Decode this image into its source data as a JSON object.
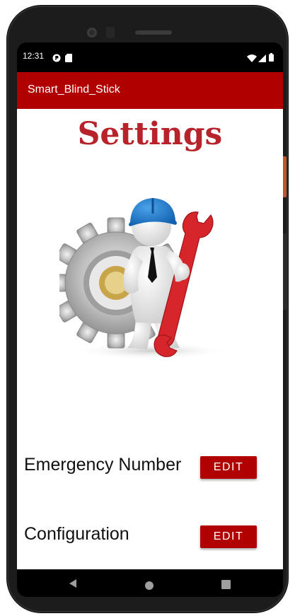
{
  "status_bar": {
    "time": "12:31",
    "left_icons": [
      "p-circle-icon",
      "sd-card-icon"
    ],
    "right_icons": [
      "wifi-icon",
      "signal-icon",
      "battery-icon"
    ]
  },
  "app_bar": {
    "title": "Smart_Blind_Stick",
    "color": "#b00000"
  },
  "main": {
    "title": "Settings",
    "title_color": "#b8222a",
    "illustration": "settings-worker-illustration",
    "rows": [
      {
        "label": "Emergency Number",
        "button_label": "EDIT"
      },
      {
        "label": "Configuration",
        "button_label": "EDIT"
      }
    ]
  },
  "nav_bar": {
    "icons": [
      "back-icon",
      "home-icon",
      "recents-icon"
    ]
  }
}
